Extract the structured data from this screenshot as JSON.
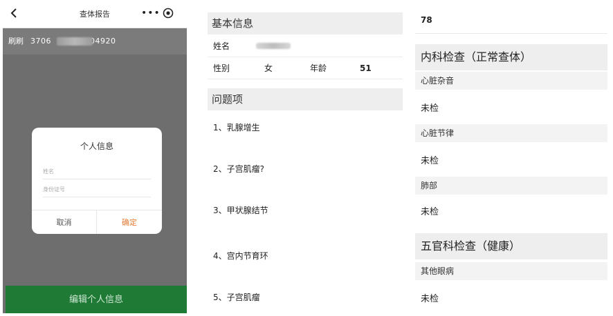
{
  "phone": {
    "title": "查体报告",
    "more": "•••",
    "id_label": "刷刷",
    "id_value_prefix": "3706",
    "id_value_suffix": "04920",
    "modal": {
      "title": "个人信息",
      "name_placeholder": "姓名",
      "id_placeholder": "身份证号",
      "cancel": "取消",
      "confirm": "确定"
    },
    "edit_button": "编辑个人信息"
  },
  "basic_info": {
    "header": "基本信息",
    "name_label": "姓名",
    "gender_label": "性别",
    "gender_value": "女",
    "age_label": "年龄",
    "age_value": "51"
  },
  "problems": {
    "header": "问题项",
    "items": [
      "1、乳腺增生",
      "2、子宫肌瘤?",
      "3、甲状腺结节",
      "4、宫内节育环",
      "5、子宫肌瘤"
    ]
  },
  "right": {
    "top_value": "78",
    "section1": {
      "header": "内科检查（正常查体）",
      "items": [
        {
          "label": "心脏杂音",
          "value": "未检"
        },
        {
          "label": "心脏节律",
          "value": "未检"
        },
        {
          "label": "肺部",
          "value": "未检"
        }
      ]
    },
    "section2": {
      "header": "五官科检查（健康）",
      "items": [
        {
          "label": "其他眼病",
          "value": "未检"
        }
      ]
    }
  },
  "colors": {
    "overlay": "#6e6e6e",
    "edit_button": "#1f7a36",
    "confirm": "#e87a33",
    "section_bg": "#eeeeee"
  }
}
